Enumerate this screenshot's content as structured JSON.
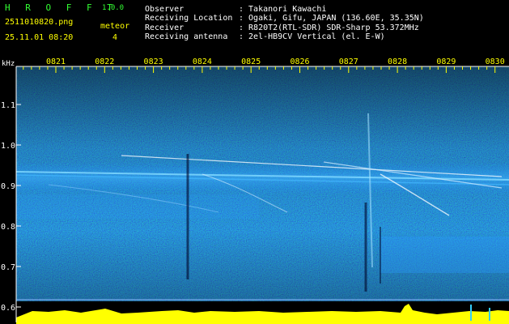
{
  "header": {
    "app_name": "H R O F F T",
    "version": "1.0.0",
    "filename": "2511010820.png",
    "datetime": "25.11.01 08:20",
    "meteor_label": "meteor",
    "meteor_count": "4",
    "observer_label": "Observer",
    "observer_value": ": Takanori Kawachi",
    "location_label": "Receiving Location",
    "location_value": ": Ogaki, Gifu, JAPAN (136.60E, 35.35N)",
    "receiver_label": "Receiver",
    "receiver_value": ": R820T2(RTL-SDR) SDR-Sharp 53.372MHz",
    "antenna_label": "Receiving antenna",
    "antenna_value": ": 2el-HB9CV Vertical (el. E-W)"
  },
  "axis": {
    "unit": "kHz",
    "y_ticks": [
      "1.1",
      "1.0",
      "0.9",
      "0.8",
      "0.7",
      "0.6"
    ],
    "x_ticks": [
      "0821",
      "0822",
      "0823",
      "0824",
      "0825",
      "0826",
      "0827",
      "0828",
      "0829",
      "0830"
    ]
  },
  "colors": {
    "background": "#000000",
    "header_text": "#ffffff",
    "app_green": "#33ff33",
    "tick_yellow": "#ffff00",
    "noise_low": "#08108a",
    "noise_high": "#1e8cff",
    "echo": "#ffffff",
    "power_trace": "#ffff00",
    "tone_line": "#7fd8ff"
  }
}
